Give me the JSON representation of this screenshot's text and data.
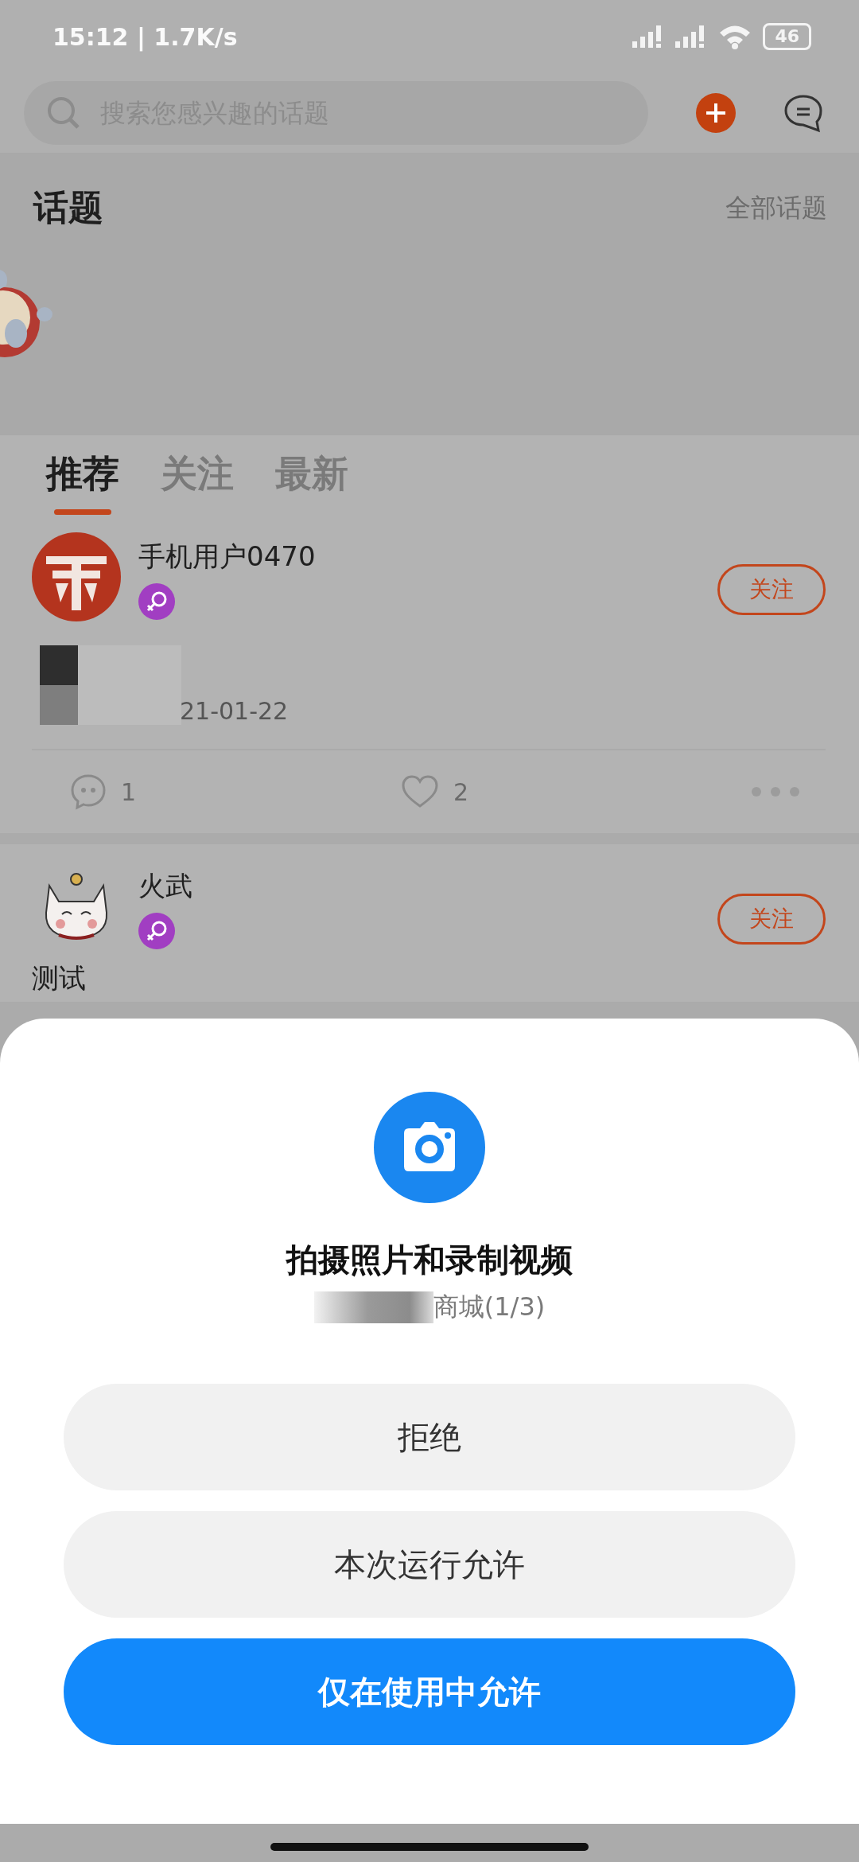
{
  "status_bar": {
    "time_speed": "15:12 | 1.7K/s",
    "battery": "46"
  },
  "search": {
    "placeholder": "搜索您感兴趣的话题"
  },
  "topics": {
    "title": "话题",
    "all_link": "全部话题"
  },
  "feed_tabs": [
    {
      "label": "推荐",
      "selected": true
    },
    {
      "label": "关注",
      "selected": false
    },
    {
      "label": "最新",
      "selected": false
    }
  ],
  "posts": [
    {
      "author": "手机用户0470",
      "avatar": {
        "kind": "seal"
      },
      "follow_label": "关注",
      "date_fragment": "21-01-22",
      "comments": "1",
      "likes": "2"
    },
    {
      "author": "火武",
      "avatar": {
        "kind": "cat"
      },
      "follow_label": "关注",
      "text": "测试"
    }
  ],
  "dialog": {
    "title": "拍摄照片和录制视频",
    "source": "商城(1/3)",
    "buttons": [
      {
        "label": "拒绝",
        "kind": "secondary"
      },
      {
        "label": "本次运行允许",
        "kind": "secondary"
      },
      {
        "label": "仅在使用中允许",
        "kind": "primary"
      }
    ]
  }
}
